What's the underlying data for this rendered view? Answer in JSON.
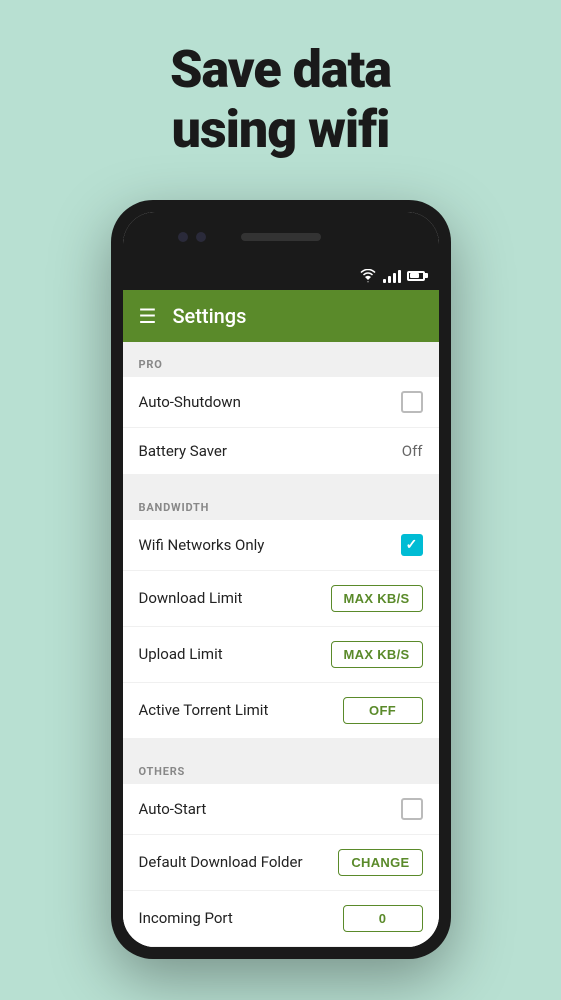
{
  "hero": {
    "title_line1": "Save data",
    "title_line2": "using wifi"
  },
  "status_bar": {
    "icons": [
      "wifi",
      "signal",
      "battery"
    ]
  },
  "toolbar": {
    "menu_icon": "☰",
    "title": "Settings"
  },
  "sections": [
    {
      "id": "pro",
      "header": "PRO",
      "items": [
        {
          "id": "auto-shutdown",
          "label": "Auto-Shutdown",
          "control": "checkbox",
          "value": false
        },
        {
          "id": "battery-saver",
          "label": "Battery Saver",
          "control": "text",
          "value": "Off"
        }
      ]
    },
    {
      "id": "bandwidth",
      "header": "BANDWIDTH",
      "items": [
        {
          "id": "wifi-networks-only",
          "label": "Wifi Networks Only",
          "control": "checkbox",
          "value": true
        },
        {
          "id": "download-limit",
          "label": "Download Limit",
          "control": "button",
          "value": "MAX KB/S"
        },
        {
          "id": "upload-limit",
          "label": "Upload Limit",
          "control": "button",
          "value": "MAX KB/S"
        },
        {
          "id": "active-torrent-limit",
          "label": "Active Torrent Limit",
          "control": "button",
          "value": "OFF"
        }
      ]
    },
    {
      "id": "others",
      "header": "OTHERS",
      "items": [
        {
          "id": "auto-start",
          "label": "Auto-Start",
          "control": "checkbox",
          "value": false
        },
        {
          "id": "default-download-folder",
          "label": "Default Download Folder",
          "control": "button",
          "value": "CHANGE"
        },
        {
          "id": "incoming-port",
          "label": "Incoming Port",
          "control": "button",
          "value": "0"
        }
      ]
    }
  ]
}
